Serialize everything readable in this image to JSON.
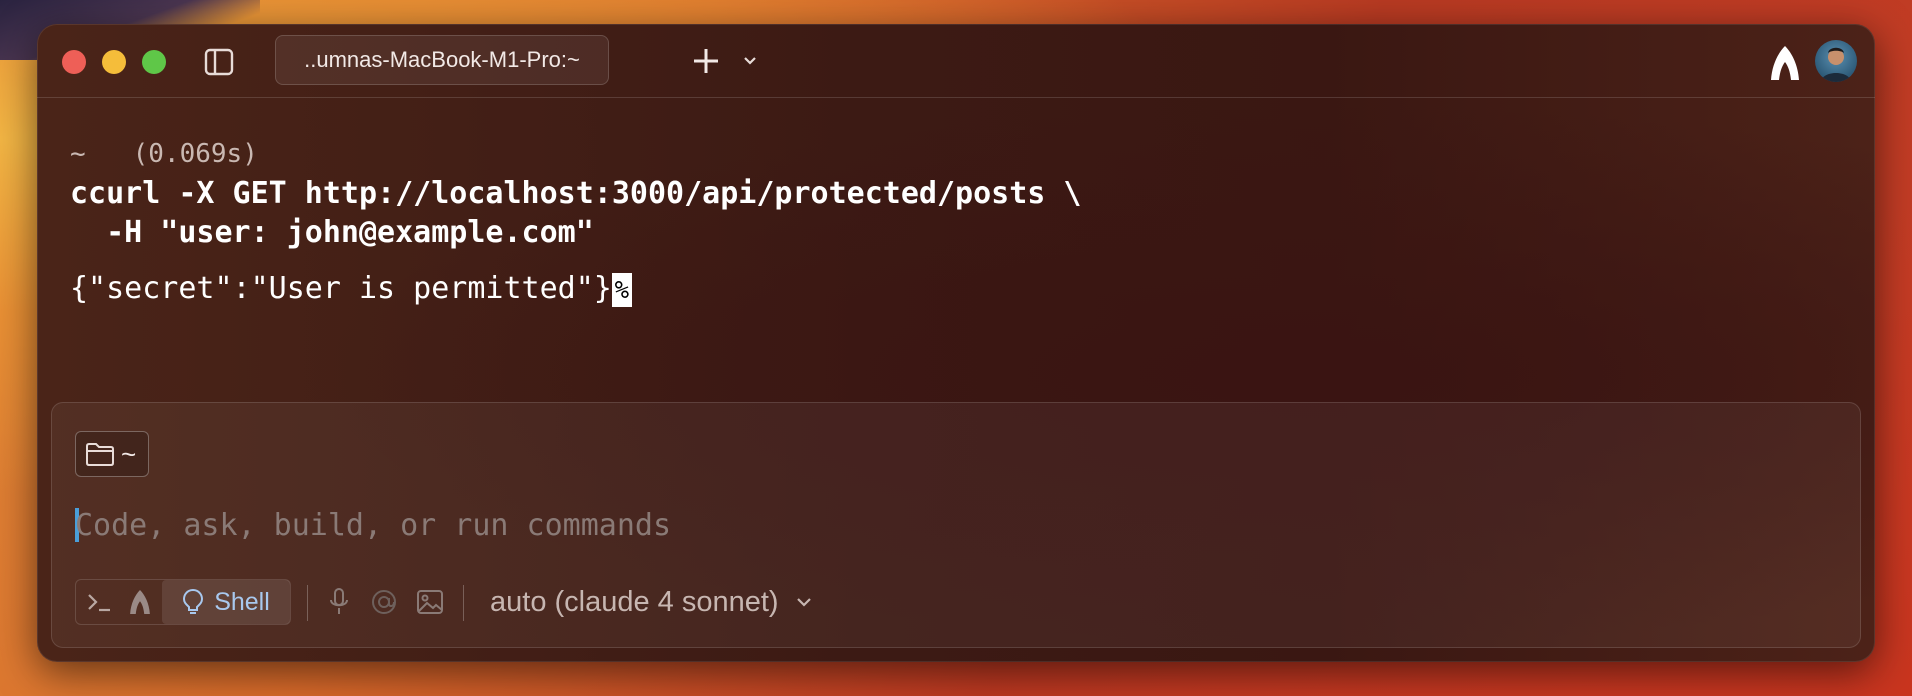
{
  "window": {
    "tab_title": "..umnas-MacBook-M1-Pro:~"
  },
  "block": {
    "directory": "~",
    "duration": "(0.069s)",
    "command_line1": "ccurl -X GET http://localhost:3000/api/protected/posts \\",
    "command_line2": "  -H \"user: john@example.com\"",
    "output": "{\"secret\":\"User is permitted\"}",
    "end_marker": "%"
  },
  "input": {
    "directory_chip": "~",
    "placeholder": "Code, ask, build, or run commands",
    "mode_label": "Shell",
    "model": "auto (claude 4 sonnet)"
  },
  "icons": {
    "titlebar": [
      "sidebar-toggle-icon",
      "plus-icon",
      "chevron-down-icon",
      "agent-logo-icon"
    ],
    "toolbar": [
      "terminal-prompt-icon",
      "agent-logo-icon",
      "lightbulb-icon",
      "microphone-icon",
      "at-sign-icon",
      "image-icon",
      "chevron-down-icon"
    ]
  },
  "colors": {
    "caret": "#4a9ed8",
    "mode_active": "#a8c8ee",
    "traffic_red": "#ee5f57",
    "traffic_yellow": "#f5bd3a",
    "traffic_green": "#5fc748"
  }
}
